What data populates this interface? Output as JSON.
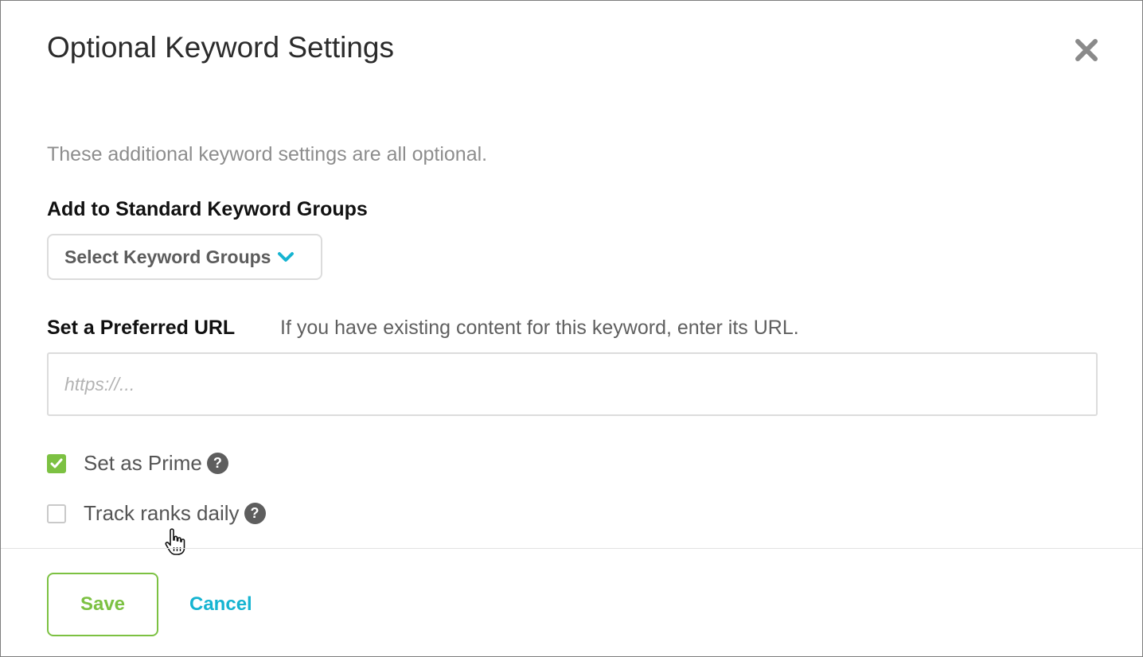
{
  "modal": {
    "title": "Optional Keyword Settings",
    "close_icon": "close-icon",
    "intro": "These additional keyword settings are all optional."
  },
  "keyword_groups": {
    "label": "Add to Standard Keyword Groups",
    "dropdown_label": "Select Keyword Groups",
    "dropdown_icon": "chevron-down-icon"
  },
  "preferred_url": {
    "label": "Set a Preferred URL",
    "help_text": "If you have existing content for this keyword, enter its URL.",
    "placeholder": "https://...",
    "value": ""
  },
  "options": {
    "prime": {
      "label": "Set as Prime",
      "checked": true,
      "help_icon": "question-icon"
    },
    "daily": {
      "label": "Track ranks daily",
      "checked": false,
      "help_icon": "question-icon"
    }
  },
  "footer": {
    "save_label": "Save",
    "cancel_label": "Cancel"
  },
  "colors": {
    "accent_green": "#7cc142",
    "accent_blue": "#16b4d1",
    "muted_text": "#8d8d8d"
  }
}
